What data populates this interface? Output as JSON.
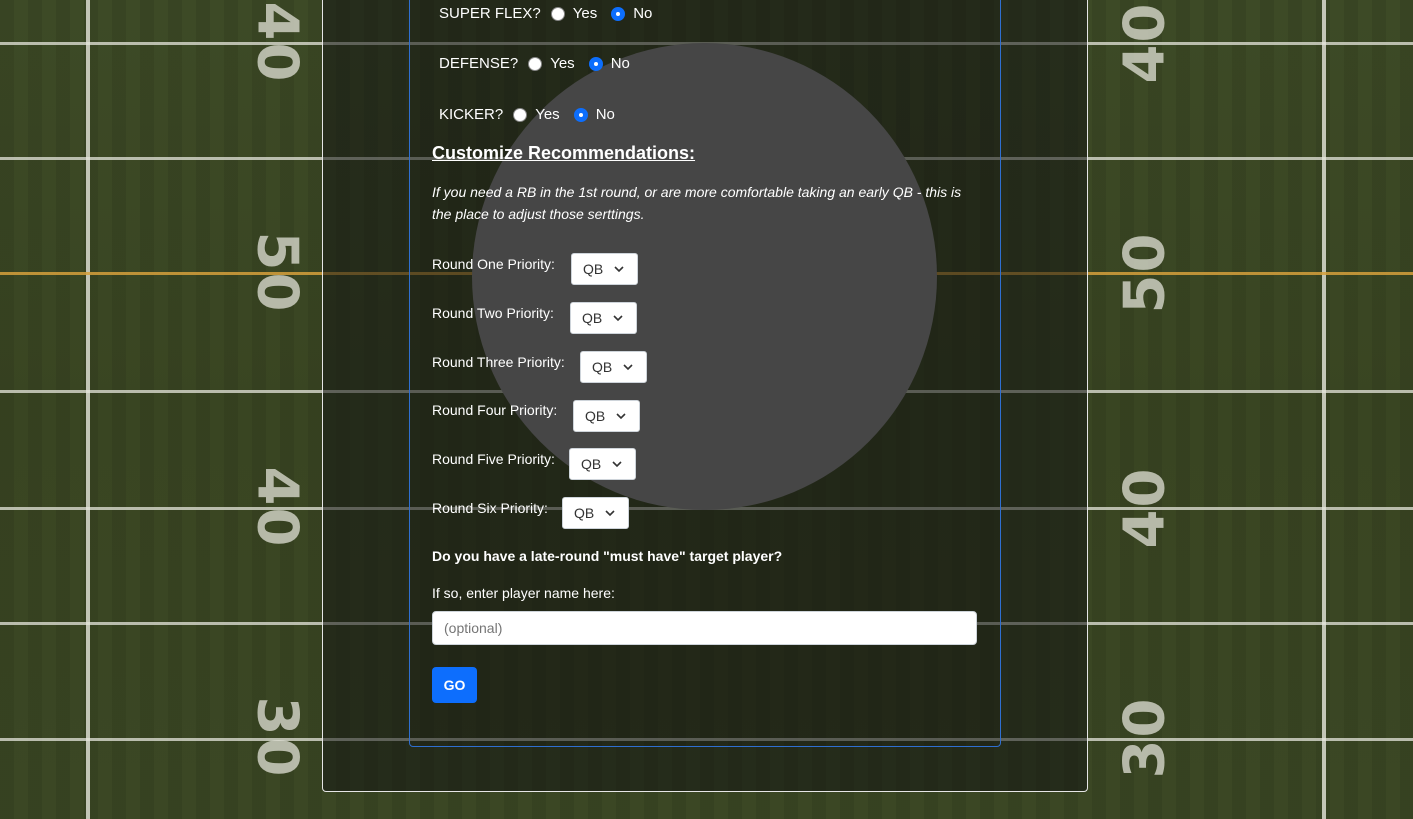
{
  "options": [
    {
      "question": "SUPER FLEX?",
      "yes": "Yes",
      "no": "No",
      "selected": "No"
    },
    {
      "question": "DEFENSE?",
      "yes": "Yes",
      "no": "No",
      "selected": "No"
    },
    {
      "question": "KICKER?",
      "yes": "Yes",
      "no": "No",
      "selected": "No"
    }
  ],
  "customize": {
    "title": "Customize Recommendations:",
    "description": "If you need a RB in the 1st round, or are more comfortable taking an early QB - this is the place to adjust those serttings."
  },
  "priorities": [
    {
      "label": "Round One Priority:",
      "value": "QB"
    },
    {
      "label": "Round Two Priority:",
      "value": "QB"
    },
    {
      "label": "Round Three Priority:",
      "value": "QB"
    },
    {
      "label": "Round Four Priority:",
      "value": "QB"
    },
    {
      "label": "Round Five Priority:",
      "value": "QB"
    },
    {
      "label": "Round Six Priority:",
      "value": "QB"
    }
  ],
  "target": {
    "question": "Do you have a late-round \"must have\" target player?",
    "prompt": "If so, enter player name here:",
    "value": "",
    "placeholder": "(optional)"
  },
  "go_label": "GO",
  "field_numbers": {
    "left": [
      "40",
      "50",
      "40",
      "30"
    ],
    "right": [
      "40",
      "50",
      "40",
      "30"
    ]
  },
  "colors": {
    "accent": "#0d6efd",
    "field": "#3a4424",
    "spinner": "#464646"
  }
}
